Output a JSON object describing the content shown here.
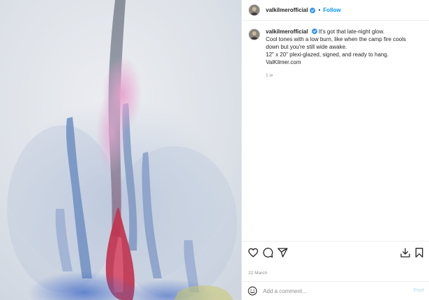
{
  "post": {
    "username": "valkilmerofficial",
    "separator": "•",
    "follow_label": "Follow",
    "caption_lines": [
      "It's got that late-night glow.",
      "Cool tones with a low burn, like when the camp fire cools",
      "down but you're still wide awake.",
      "12\" x 20\" plexi-glazed, signed, and ready to hang.",
      "ValKilmer.com"
    ],
    "age": "1 w",
    "date": "22 March",
    "comment_placeholder": "Add a comment...",
    "post_label": "Post"
  },
  "icons": {
    "verified": "verified-badge-icon",
    "like": "heart-icon",
    "comment": "speech-bubble-icon",
    "share": "paper-plane-icon",
    "save": "download-icon",
    "bookmark": "bookmark-icon",
    "emoji": "smiley-icon"
  },
  "colors": {
    "link_blue": "#0095f6",
    "verified_blue": "#3897f0",
    "muted_text": "#8e8e8e",
    "post_disabled": "#c7e4fb"
  }
}
